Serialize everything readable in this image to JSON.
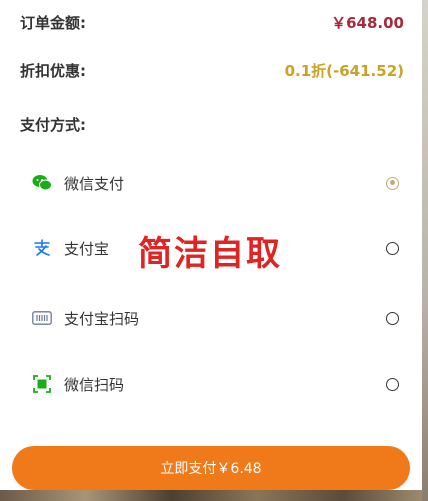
{
  "order": {
    "amount_label": "订单金额:",
    "amount_value": "￥648.00",
    "discount_label": "折扣优惠:",
    "discount_value": "0.1折(-641.52)"
  },
  "payment": {
    "section_title": "支付方式:",
    "methods": [
      {
        "label": "微信支付",
        "icon": "wechat-icon",
        "selected": true
      },
      {
        "label": "支付宝",
        "icon": "alipay-icon",
        "selected": false
      },
      {
        "label": "支付宝扫码",
        "icon": "barcode-icon",
        "selected": false
      },
      {
        "label": "微信扫码",
        "icon": "scan-icon",
        "selected": false
      }
    ]
  },
  "overlay": {
    "text": "简洁自取"
  },
  "action": {
    "pay_label": "立即支付￥6.48"
  },
  "colors": {
    "price_red": "#a52a3a",
    "discount_gold": "#c9a227",
    "wechat_green": "#1aad19",
    "alipay_blue": "#1677ff",
    "button_orange": "#f07a1a",
    "overlay_red": "#e02424"
  }
}
